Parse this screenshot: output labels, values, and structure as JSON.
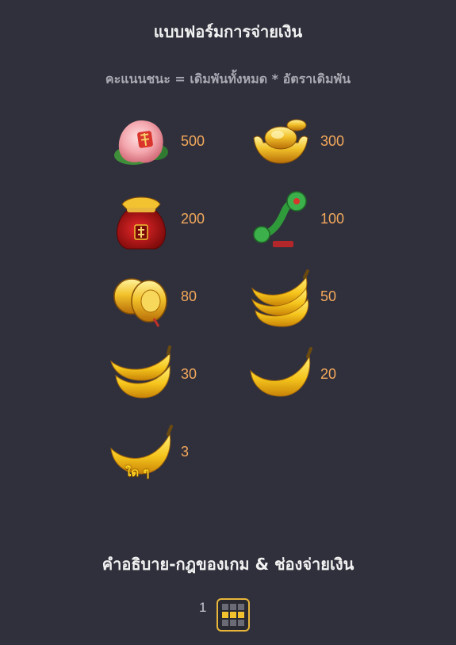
{
  "header": {
    "title": "แบบฟอร์มการจ่ายเงิน",
    "formula": "คะแนนชนะ = เดิมพันทั้งหมด * อัตราเดิมพัน"
  },
  "paytable": [
    {
      "symbol": "peach-icon",
      "value": "500"
    },
    {
      "symbol": "gold-ingot-icon",
      "value": "300"
    },
    {
      "symbol": "lucky-bag-icon",
      "value": "200"
    },
    {
      "symbol": "jade-ruyi-icon",
      "value": "100"
    },
    {
      "symbol": "gong-icon",
      "value": "80"
    },
    {
      "symbol": "banana-bunch-three-icon",
      "value": "50"
    },
    {
      "symbol": "banana-bunch-two-icon",
      "value": "30"
    },
    {
      "symbol": "banana-single-icon",
      "value": "20"
    },
    {
      "symbol": "banana-wild-icon",
      "value": "3",
      "tag": "ใด ๆ"
    }
  ],
  "footer": {
    "title": "คำอธิบาย-กฎของเกม & ช่องจ่ายเงิน",
    "page": "1"
  },
  "colors": {
    "background": "#30303c",
    "value": "#f3a85b",
    "accent": "#e8b63a"
  }
}
